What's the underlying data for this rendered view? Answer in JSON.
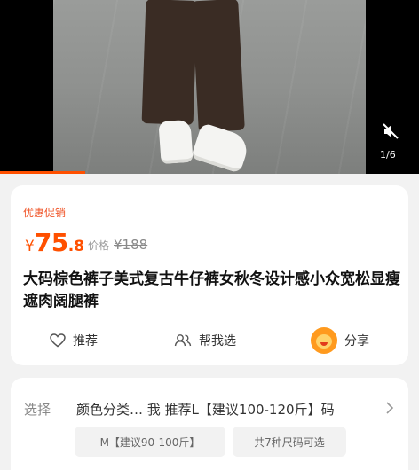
{
  "media": {
    "counter": "1/6",
    "icons": [
      "mute-icon"
    ]
  },
  "product": {
    "promo_label": "优惠促销",
    "price_currency": "¥",
    "price_int": "75",
    "price_dec": ".8",
    "orig_label": "价格",
    "orig_price": "¥188",
    "title": "大码棕色裤子美式复古牛仔裤女秋冬设计感小众宽松显瘦遮肉阔腿裤"
  },
  "actions": {
    "recommend": "推荐",
    "help_choose": "帮我选",
    "share": "分享"
  },
  "selection": {
    "label": "选择",
    "value": "颜色分类… 我 推荐L【建议100-120斤】码",
    "chips": [
      "M【建议90-100斤】",
      "共7种尺码可选"
    ]
  },
  "colors": {
    "accent": "#ff5000",
    "promo": "#f0562a"
  }
}
